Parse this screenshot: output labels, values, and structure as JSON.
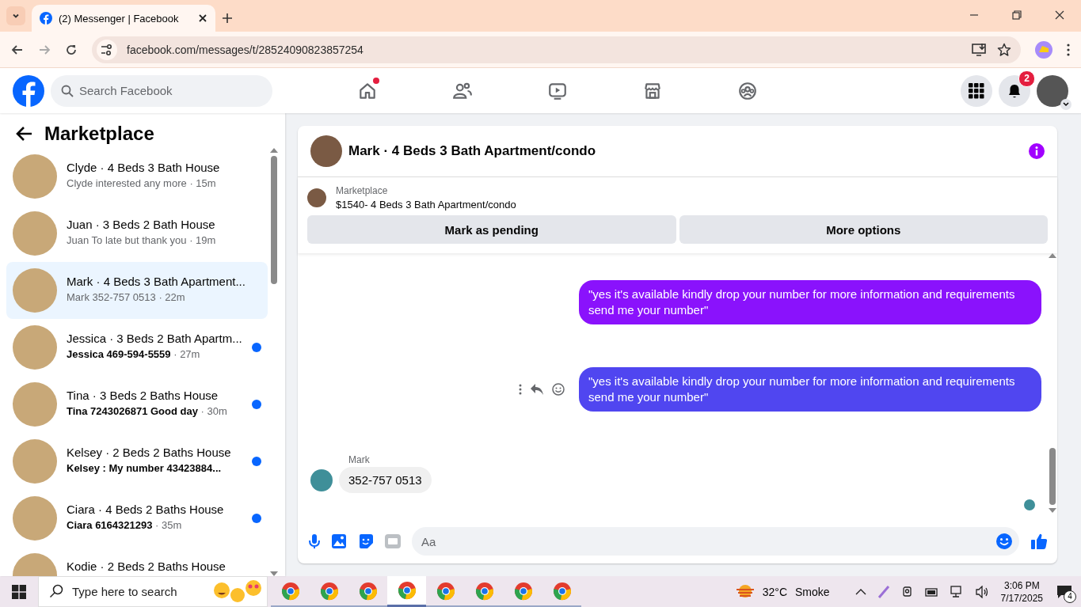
{
  "browser": {
    "tab_title": "(2) Messenger | Facebook",
    "url": "facebook.com/messages/t/28524090823857254"
  },
  "header": {
    "search_placeholder": "Search Facebook",
    "nav": [
      {
        "kind": "home",
        "dot": true
      },
      {
        "kind": "friends",
        "dot": false
      },
      {
        "kind": "video",
        "dot": false
      },
      {
        "kind": "marketplace",
        "dot": false
      },
      {
        "kind": "groups",
        "dot": false
      }
    ],
    "notification_count": "2"
  },
  "sidebar": {
    "title": "Marketplace",
    "conversations": [
      {
        "title": "Clyde · 4 Beds 3 Bath House",
        "preview": "Clyde interested any more",
        "time": "· 15m",
        "unread": false,
        "selected": false
      },
      {
        "title": "Juan · 3 Beds 2 Bath House",
        "preview": "Juan To late but thank you",
        "time": "· 19m",
        "unread": false,
        "selected": false
      },
      {
        "title": "Mark · 4 Beds 3 Bath Apartment...",
        "preview": "Mark 352-757 0513",
        "time": "· 22m",
        "unread": false,
        "selected": true
      },
      {
        "title": "Jessica · 3 Beds 2 Bath Apartm...",
        "preview": "Jessica 469-594-5559",
        "time": "· 27m",
        "unread": true,
        "selected": false
      },
      {
        "title": "Tina · 3 Beds 2 Baths House",
        "preview": "Tina 7243026871 Good day",
        "time": "· 30m",
        "unread": true,
        "selected": false
      },
      {
        "title": "Kelsey · 2 Beds 2 Baths House",
        "preview": "Kelsey : My number 43423884...",
        "unread": true,
        "selected": false
      },
      {
        "title": "Ciara · 4 Beds 2 Baths House",
        "preview": "Ciara 6164321293",
        "time": "· 35m",
        "unread": true,
        "selected": false
      },
      {
        "title": "Kodie · 2 Beds 2 Baths House",
        "unread": false,
        "selected": false
      }
    ]
  },
  "chat": {
    "title": "Mark · 4 Beds 3 Bath Apartment/condo",
    "listing": {
      "label": "Marketplace",
      "text": "$1540- 4 Beds 3 Bath Apartment/condo"
    },
    "buttons": [
      "Mark as pending",
      "More options"
    ],
    "messages": [
      {
        "kind": "outgoing",
        "text": "\"yes it's available kindly drop your number for more information and requirements send me your number\"",
        "color": "#8a12fc",
        "actions": false
      },
      {
        "kind": "outgoing",
        "text": "\"yes it's available kindly drop your number for more information and requirements send me your number\"",
        "color": "#5046f0",
        "actions": true
      },
      {
        "kind": "incoming",
        "sender": "Mark",
        "text": "352-757 0513"
      }
    ],
    "composer_placeholder": "Aa"
  },
  "taskbar": {
    "search_placeholder": "Type here to search",
    "apps": [
      {
        "selected": false
      },
      {
        "selected": false
      },
      {
        "selected": false
      },
      {
        "selected": true
      },
      {
        "selected": false
      },
      {
        "selected": false
      },
      {
        "selected": false
      },
      {
        "selected": false
      }
    ],
    "temperature": "32°C",
    "condition": "Smoke",
    "time": "3:06 PM",
    "date": "7/17/2025",
    "notification_count": "4"
  }
}
